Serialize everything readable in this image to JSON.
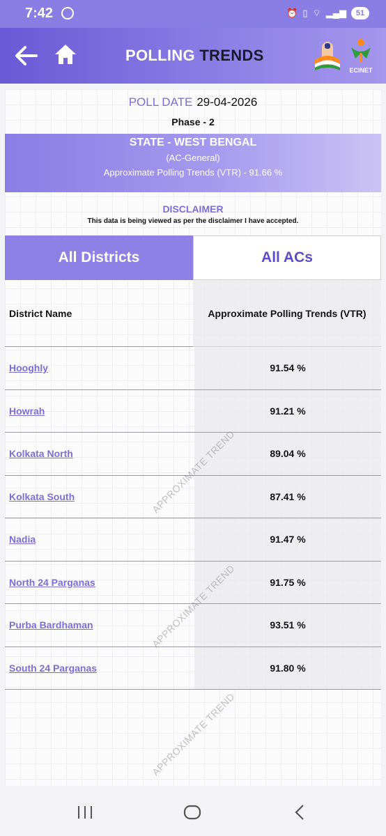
{
  "status_bar": {
    "time": "7:42",
    "battery": "51"
  },
  "header": {
    "title_part1": "POLLING",
    "title_part2": "TRENDS",
    "logo_label": "ECINET"
  },
  "poll": {
    "date_label": "POLL DATE",
    "date_value": "29-04-2026",
    "phase": "Phase - 2"
  },
  "state": {
    "name": "STATE - WEST BENGAL",
    "type": "(AC-General)",
    "vtr": "Approximate Polling Trends (VTR) - 91.66 %"
  },
  "disclaimer": {
    "title": "DISCLAIMER",
    "text": "This data is being viewed as per the disclaimer I have accepted."
  },
  "tabs": [
    {
      "label": "All Districts",
      "active": true
    },
    {
      "label": "All ACs",
      "active": false
    }
  ],
  "table": {
    "headers": {
      "district": "District Name",
      "vtr": "Approximate Polling Trends (VTR)"
    },
    "rows": [
      {
        "district": "Hooghly",
        "vtr": "91.54 %"
      },
      {
        "district": "Howrah",
        "vtr": "91.21 %"
      },
      {
        "district": "Kolkata North",
        "vtr": "89.04 %"
      },
      {
        "district": "Kolkata South",
        "vtr": "87.41 %"
      },
      {
        "district": "Nadia",
        "vtr": "91.47 %"
      },
      {
        "district": "North 24 Parganas",
        "vtr": "91.75 %"
      },
      {
        "district": "Purba Bardhaman",
        "vtr": "93.51 %"
      },
      {
        "district": "South 24  Parganas",
        "vtr": "91.80 %"
      }
    ]
  },
  "watermark": "APPROXIMATE TREND",
  "colors": {
    "accent": "#8f80e6",
    "link": "#7b6fd6",
    "dark_accent": "#5b4ccc"
  }
}
